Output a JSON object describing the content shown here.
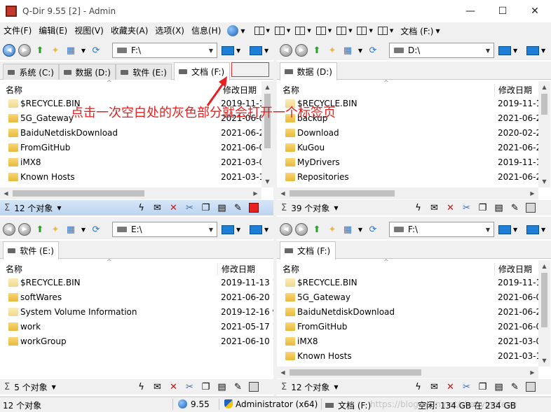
{
  "window": {
    "title": "Q-Dir 9.55 [2] - Admin",
    "minimize": "—",
    "maximize": "☐",
    "close": "✕"
  },
  "menu": {
    "items": [
      "文件(F)",
      "编辑(E)",
      "视图(V)",
      "收藏夹(A)",
      "选项(X)",
      "信息(H)"
    ],
    "drive": "文档 (F:)",
    "drive_arrow": "▼"
  },
  "annotation": {
    "text": "点击一次空白处的灰色部分就会打开一个标签页",
    "color": "#e62020"
  },
  "columns": {
    "name": "名称",
    "date": "修改日期",
    "sort_indicator": "^"
  },
  "panes": [
    {
      "path": "F:\\",
      "tabs": [
        {
          "label": "系统 (C:)",
          "active": false
        },
        {
          "label": "数据 (D:)",
          "active": false
        },
        {
          "label": "软件 (E:)",
          "active": false
        },
        {
          "label": "文档 (F:)",
          "active": true
        }
      ],
      "rows": [
        {
          "name": "$RECYCLE.BIN",
          "date": "2019-11-1"
        },
        {
          "name": "5G_Gateway",
          "date": "2021-06-0"
        },
        {
          "name": "BaiduNetdiskDownload",
          "date": "2021-06-2"
        },
        {
          "name": "FromGitHub",
          "date": "2021-06-0"
        },
        {
          "name": "iMX8",
          "date": "2021-03-0"
        },
        {
          "name": "Known Hosts",
          "date": "2021-03-1"
        }
      ],
      "count": "12 个对象"
    },
    {
      "path": "D:\\",
      "tabs": [
        {
          "label": "数据 (D:)",
          "active": true
        }
      ],
      "rows": [
        {
          "name": "$RECYCLE.BIN",
          "date": "2019-11-1"
        },
        {
          "name": "backup",
          "date": "2021-06-2"
        },
        {
          "name": "Download",
          "date": "2020-02-2"
        },
        {
          "name": "KuGou",
          "date": "2021-06-2"
        },
        {
          "name": "MyDrivers",
          "date": "2019-11-1"
        },
        {
          "name": "Repositories",
          "date": "2021-06-2"
        }
      ],
      "count": "39 个对象"
    },
    {
      "path": "E:\\",
      "tabs": [
        {
          "label": "软件 (E:)",
          "active": true
        }
      ],
      "rows": [
        {
          "name": "$RECYCLE.BIN",
          "date": "2019-11-13 1"
        },
        {
          "name": "softWares",
          "date": "2021-06-20 1"
        },
        {
          "name": "System Volume Information",
          "date": "2019-12-16 9"
        },
        {
          "name": "work",
          "date": "2021-05-17 1"
        },
        {
          "name": "workGroup",
          "date": "2021-06-10 1"
        }
      ],
      "count": "5 个对象"
    },
    {
      "path": "F:\\",
      "tabs": [
        {
          "label": "文档 (F:)",
          "active": true
        }
      ],
      "rows": [
        {
          "name": "$RECYCLE.BIN",
          "date": "2019-11-1"
        },
        {
          "name": "5G_Gateway",
          "date": "2021-06-0"
        },
        {
          "name": "BaiduNetdiskDownload",
          "date": "2021-06-2"
        },
        {
          "name": "FromGitHub",
          "date": "2021-06-0"
        },
        {
          "name": "iMX8",
          "date": "2021-03-0"
        },
        {
          "name": "Known Hosts",
          "date": "2021-03-1"
        }
      ],
      "count": "12 个对象"
    }
  ],
  "statusbar": {
    "count": "12 个对象",
    "version": "9.55",
    "user": "Administrator (x64)",
    "drive": "文档 (F:)",
    "free": "空闲: 134 GB 在 234 GB",
    "watermark": "https://blog.csdn.net/shaoyingfeng"
  }
}
